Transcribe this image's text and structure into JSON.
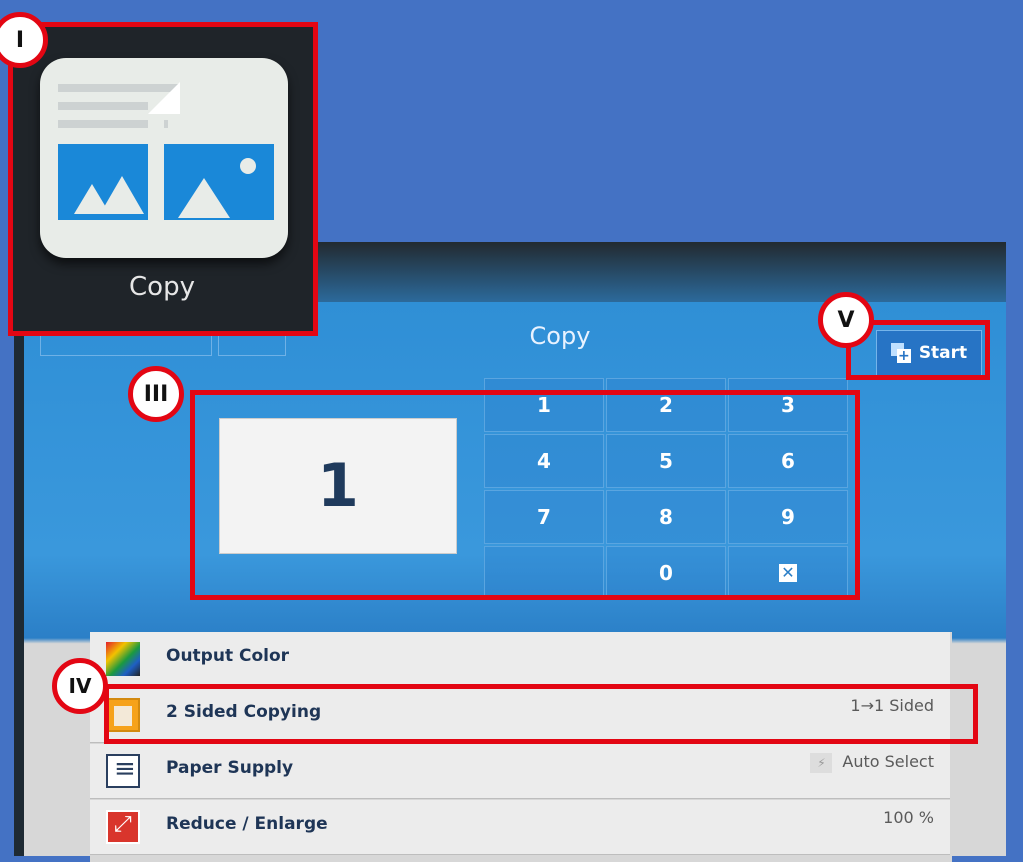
{
  "tile": {
    "label": "Copy",
    "icon": "copy-app-icon"
  },
  "screen": {
    "title": "Copy",
    "start_button": {
      "label": "Start",
      "icon": "start-icon"
    },
    "copy_count": "1",
    "keypad": [
      "1",
      "2",
      "3",
      "4",
      "5",
      "6",
      "7",
      "8",
      "9",
      "0"
    ],
    "clear_icon": "clear-icon",
    "settings": [
      {
        "label": "Output Color",
        "value": "",
        "icon": "output-color-icon"
      },
      {
        "label": "2 Sided Copying",
        "value": "1→1 Sided",
        "icon": "two-sided-icon"
      },
      {
        "label": "Paper Supply",
        "value": "Auto Select",
        "icon": "paper-supply-icon"
      },
      {
        "label": "Reduce / Enlarge",
        "value": "100 %",
        "icon": "reduce-enlarge-icon"
      }
    ]
  },
  "annotations": {
    "I": "I",
    "III": "III",
    "IV": "IV",
    "V": "V"
  },
  "colors": {
    "annotation": "#e30613",
    "background": "#4472c4",
    "screen_blue": "#2f8fd6"
  }
}
